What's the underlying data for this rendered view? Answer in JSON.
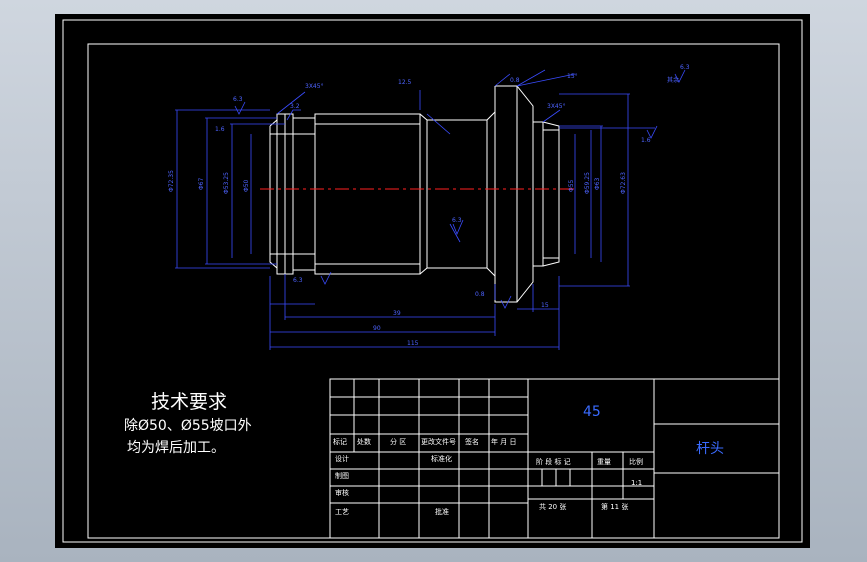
{
  "requirements": {
    "title": "技术要求",
    "line1": "除Ø50、Ø55坡口外",
    "line2": "均为焊后加工。"
  },
  "title_block": {
    "material": "45",
    "part_name": "杆头",
    "scale": "1:1",
    "labels": {
      "mark": "标记",
      "count": "处数",
      "zone": "分 区",
      "doc_no": "更改文件号",
      "sign": "签名",
      "date": "年 月 日",
      "design": "设计",
      "standard": "标准化",
      "drafter": "制图",
      "review": "审核",
      "process": "工艺",
      "approve": "批准",
      "stage_mark": "阶 段 标 记",
      "weight": "重量",
      "scale_label": "比例",
      "total_sheets": "共 20 张",
      "sheet_no": "第 11 张"
    }
  },
  "dims": {
    "d_left_outer": "Φ72.35",
    "d_left_mid": "Φ67",
    "d_left_in1": "Φ53.25",
    "d_left_in2": "Φ50",
    "d_right_outer": "Φ72.63",
    "d_right_mid": "Φ63",
    "d_right_in1": "Φ59.25",
    "d_right_in2": "Φ55",
    "cham_left": "3X45°",
    "cham_right": "3X45°",
    "len_total": "115",
    "len_mid": "90",
    "len_part": "39",
    "len_small": "15",
    "angle": "15°",
    "rough_a": "6.3",
    "rough_b": "1.6",
    "rough_c": "3.2",
    "rough_d": "12.5",
    "rough_e": "0.8",
    "rough_f": "6.3",
    "rough_g": "1.6",
    "rough_h": "6.3",
    "rough_i": "0.8",
    "rough_all": "6.3",
    "rest_label": "其余"
  }
}
